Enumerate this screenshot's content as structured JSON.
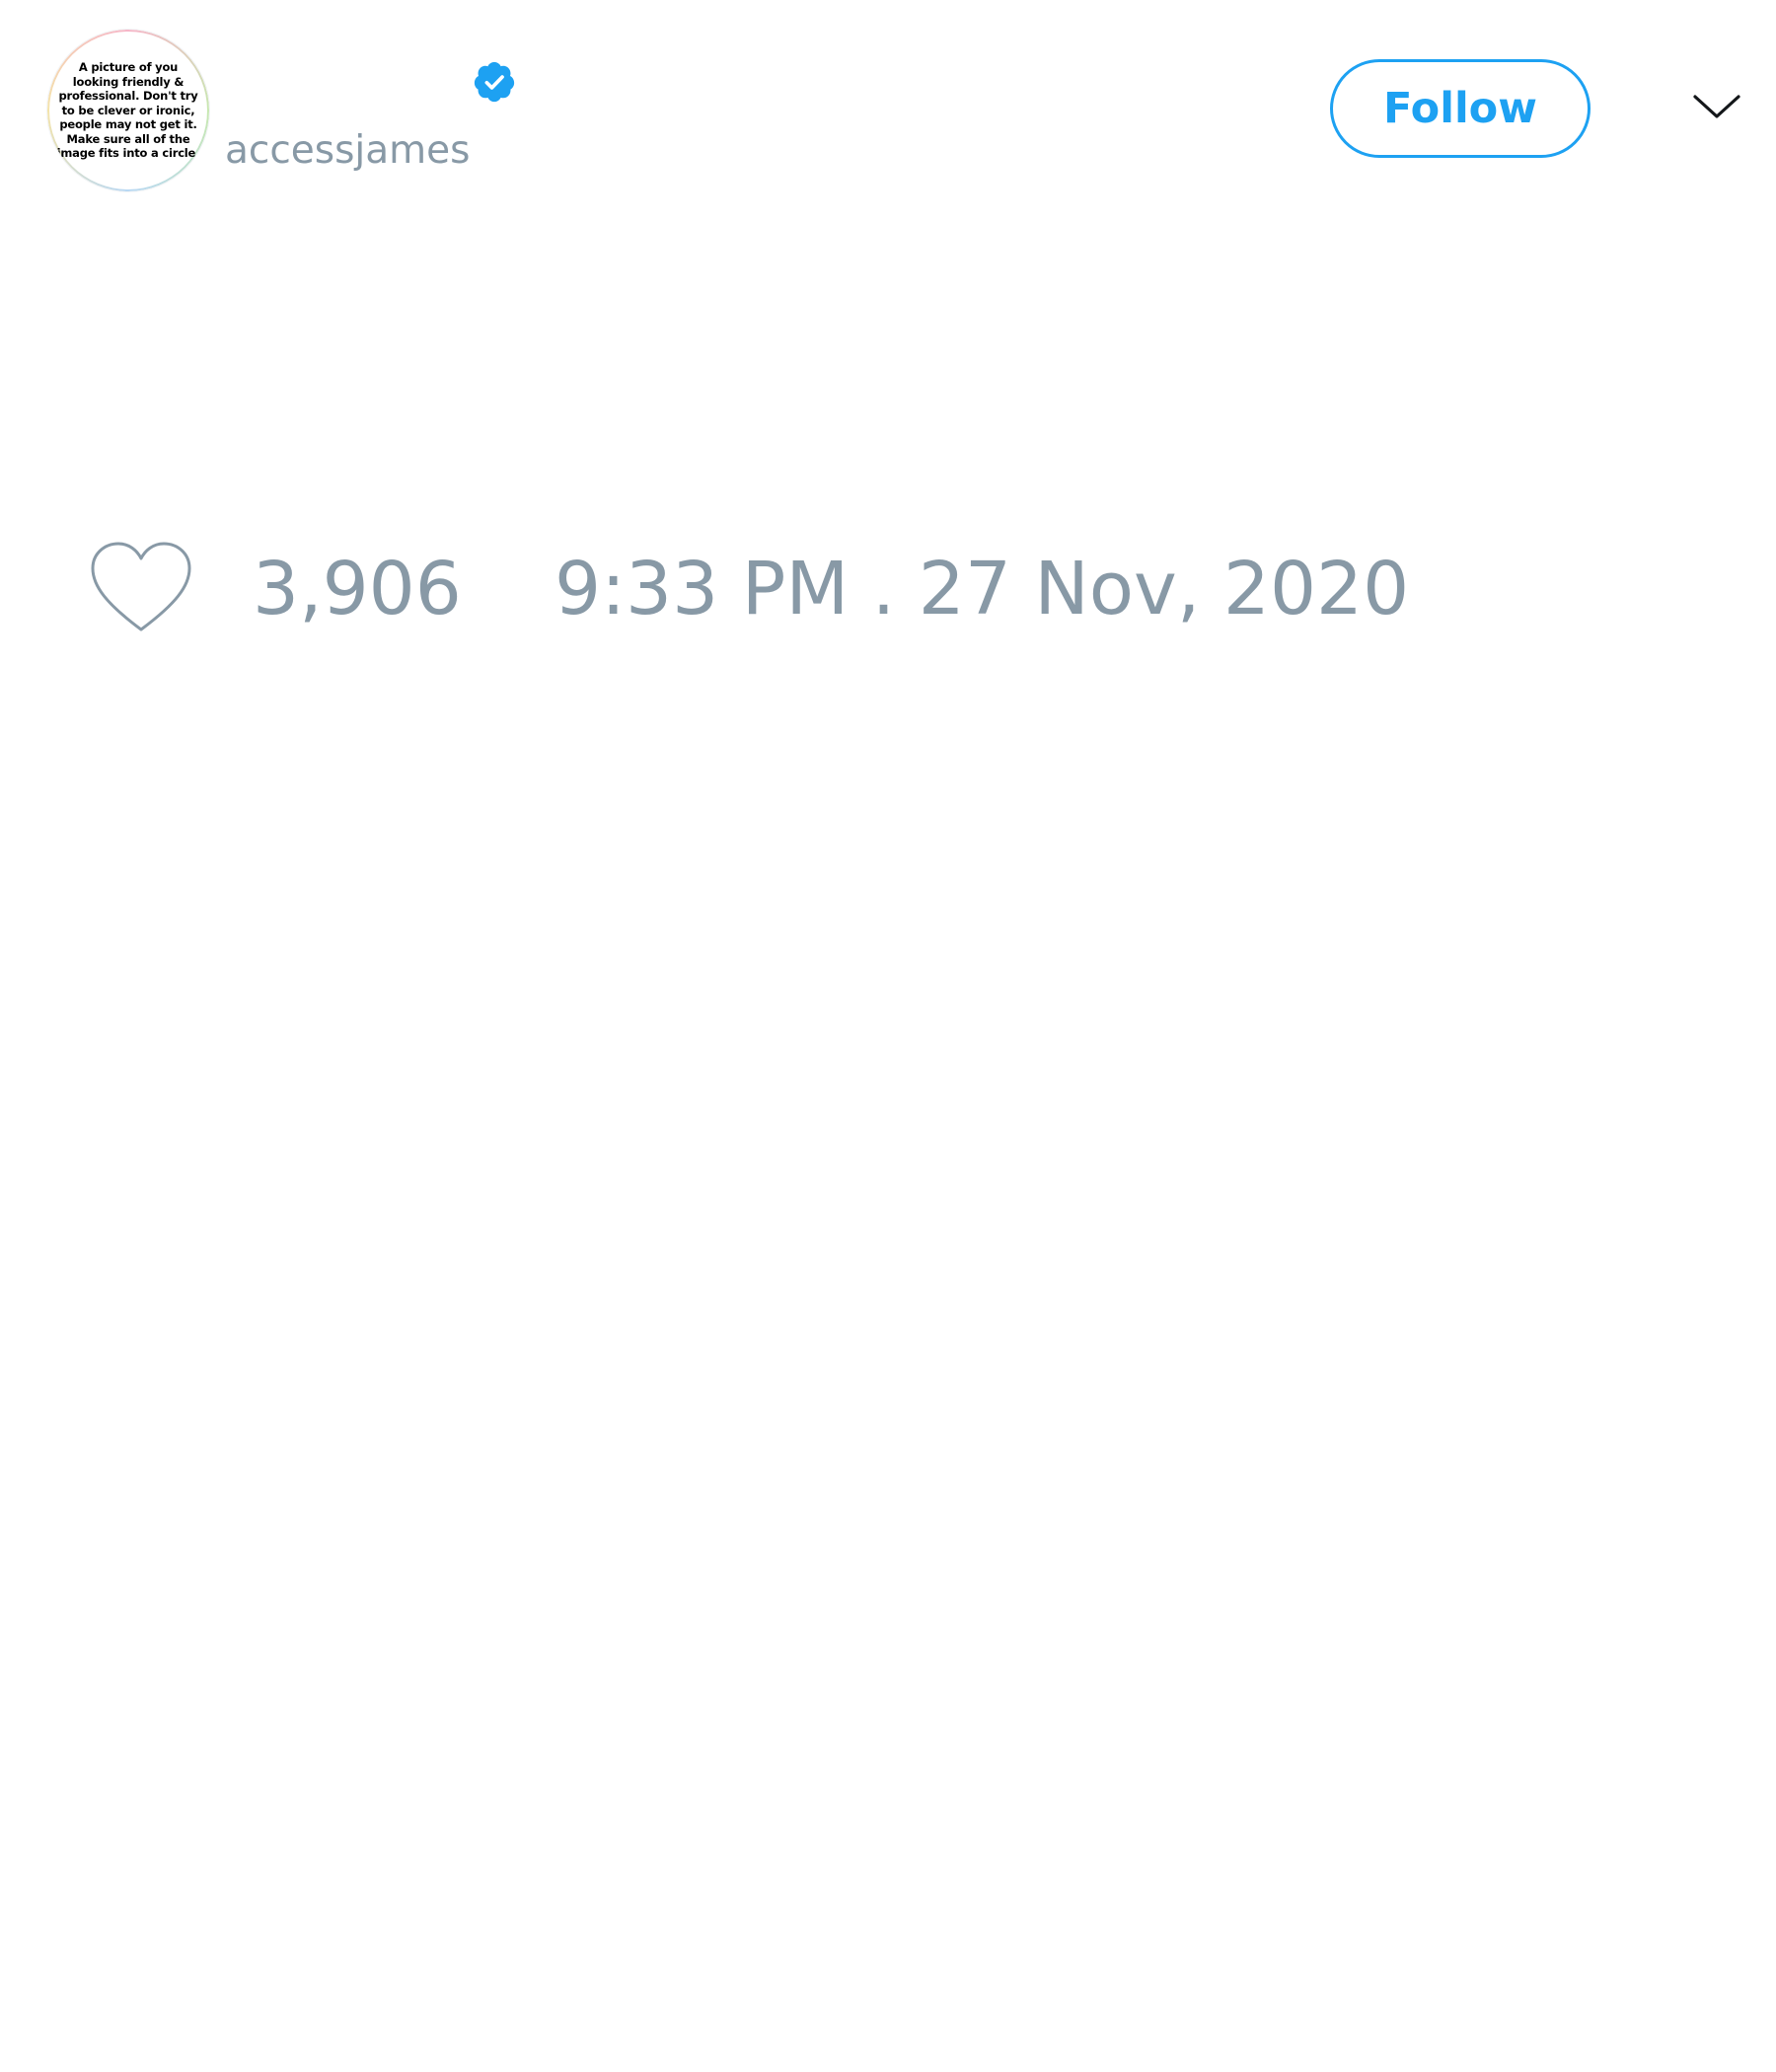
{
  "tweet": {
    "author": {
      "avatar_text": "A picture of you looking friendly & professional. Don't try to be clever or ironic, people may not get it. Make sure all of the image fits into a circle.",
      "verified": true,
      "handle": "accessjames"
    },
    "actions": {
      "follow_label": "Follow",
      "menu_icon": "chevron-down-icon"
    },
    "metrics": {
      "like_icon": "heart-icon",
      "like_count": "3,906",
      "timestamp": "9:33 PM . 27 Nov, 2020"
    }
  },
  "colors": {
    "accent": "#1da1f2",
    "muted_text": "#8899a6",
    "background": "#ffffff"
  }
}
